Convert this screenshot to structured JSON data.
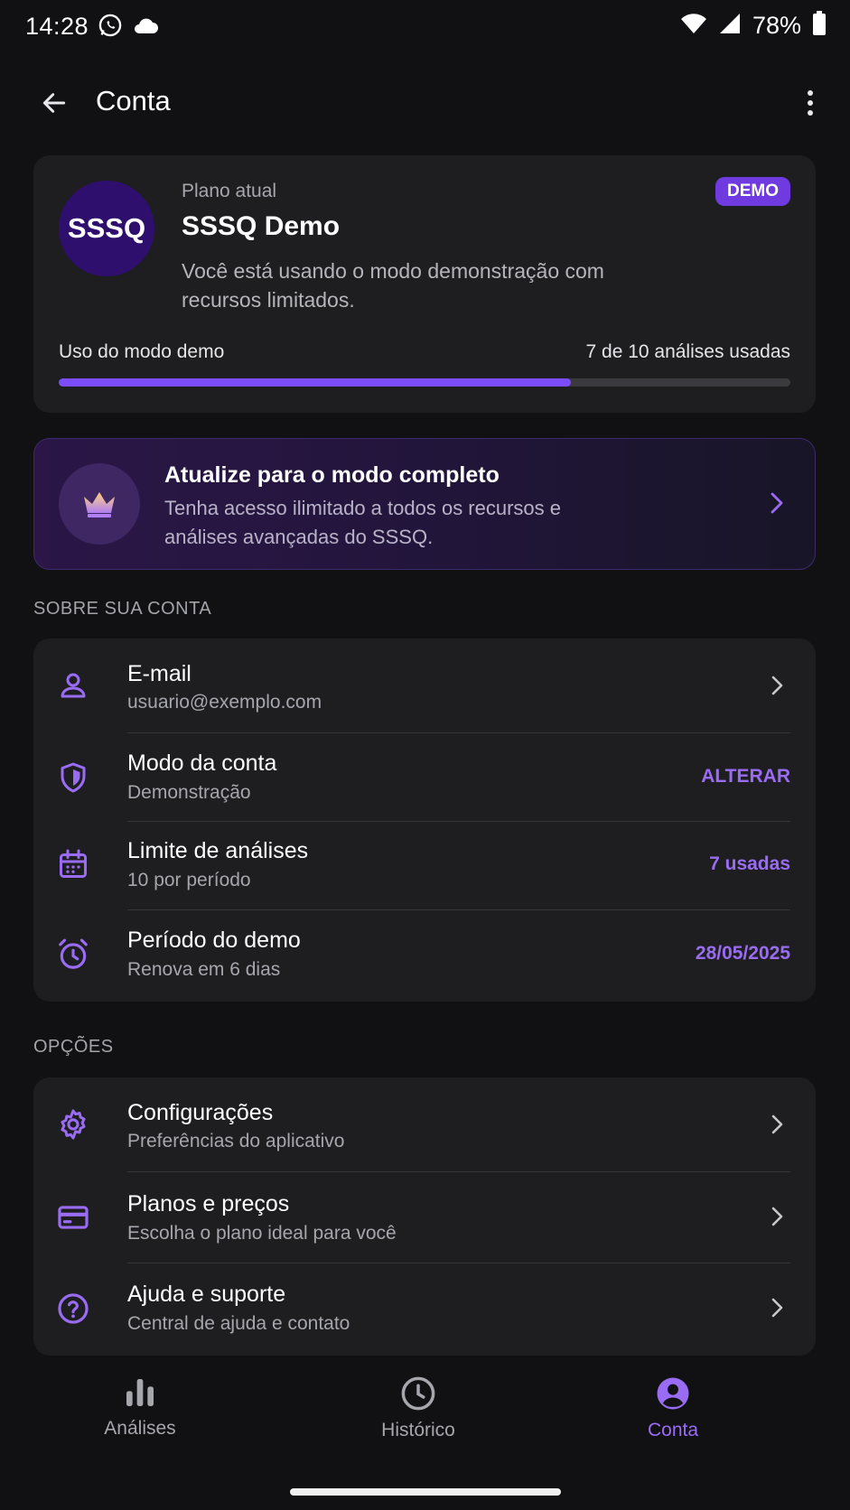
{
  "status_bar": {
    "time": "14:28",
    "battery": "78%"
  },
  "app_bar": {
    "title": "Conta"
  },
  "plan": {
    "avatar_text": "SSSQ",
    "label": "Plano atual",
    "name": "SSSQ Demo",
    "badge": "DEMO",
    "description": "Você está usando o modo demonstração com recursos limitados.",
    "usage_label": "Uso do modo demo",
    "usage_count": "7 de 10 análises usadas",
    "usage_fraction": 0.7
  },
  "upgrade": {
    "title": "Atualize para o modo completo",
    "description": "Tenha acesso ilimitado a todos os recursos e análises avançadas do SSSQ."
  },
  "account_section": {
    "header": "SOBRE SUA CONTA",
    "items": [
      {
        "title": "E-mail",
        "subtitle": "usuario@exemplo.com",
        "icon": "person-icon"
      },
      {
        "title": "Modo da conta",
        "subtitle": "Demonstração",
        "value": "ALTERAR",
        "icon": "shield-icon"
      },
      {
        "title": "Limite de análises",
        "subtitle": "10 por período",
        "value": "7 usadas",
        "icon": "calendar-icon"
      },
      {
        "title": "Período do demo",
        "subtitle": "Renova em 6 dias",
        "value": "28/05/2025",
        "icon": "alarm-icon"
      }
    ]
  },
  "options_section": {
    "header": "OPÇÕES",
    "items": [
      {
        "title": "Configurações",
        "subtitle": "Preferências do aplicativo",
        "icon": "gear-icon"
      },
      {
        "title": "Planos e preços",
        "subtitle": "Escolha o plano ideal para você",
        "icon": "credit-card-icon"
      },
      {
        "title": "Ajuda e suporte",
        "subtitle": "Central de ajuda e contato",
        "icon": "help-icon"
      }
    ]
  },
  "bottom_nav": {
    "items": [
      {
        "label": "Análises",
        "icon": "bar-chart-icon"
      },
      {
        "label": "Histórico",
        "icon": "clock-icon"
      },
      {
        "label": "Conta",
        "icon": "account-circle-icon",
        "active": true
      }
    ]
  },
  "colors": {
    "accent": "#9a6cf4",
    "progress": "#7c4dff",
    "badge": "#6f3be0",
    "background": "#111114",
    "card": "#1e1e21"
  }
}
